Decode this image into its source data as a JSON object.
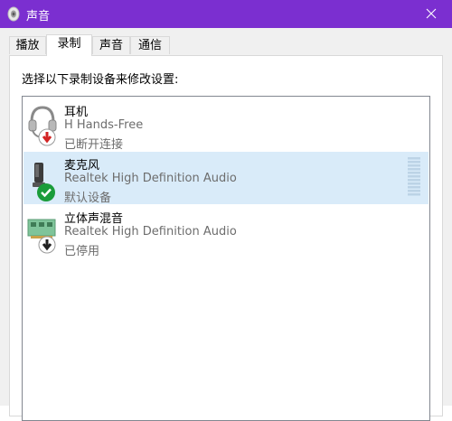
{
  "window": {
    "title": "声音"
  },
  "tabs": [
    {
      "label": "播放"
    },
    {
      "label": "录制"
    },
    {
      "label": "声音"
    },
    {
      "label": "通信"
    }
  ],
  "active_tab": "录制",
  "panel": {
    "instruction": "选择以下录制设备来修改设置:"
  },
  "devices": [
    {
      "name": "耳机",
      "description": "H Hands-Free",
      "status": "已断开连接",
      "icon": "headset-icon",
      "badge": "disconnected-arrow-badge"
    },
    {
      "name": "麦克风",
      "description": "Realtek High Definition Audio",
      "status": "默认设备",
      "icon": "microphone-icon",
      "badge": "default-checkmark-badge",
      "selected": true
    },
    {
      "name": "立体声混音",
      "description": "Realtek High Definition Audio",
      "status": "已停用",
      "icon": "sound-card-icon",
      "badge": "disabled-arrow-badge"
    }
  ],
  "colors": {
    "titlebar": "#7b2fd0",
    "selection": "#d9ebf9",
    "check_badge": "#1a9c3a",
    "disconnected_badge": "#d22323"
  }
}
